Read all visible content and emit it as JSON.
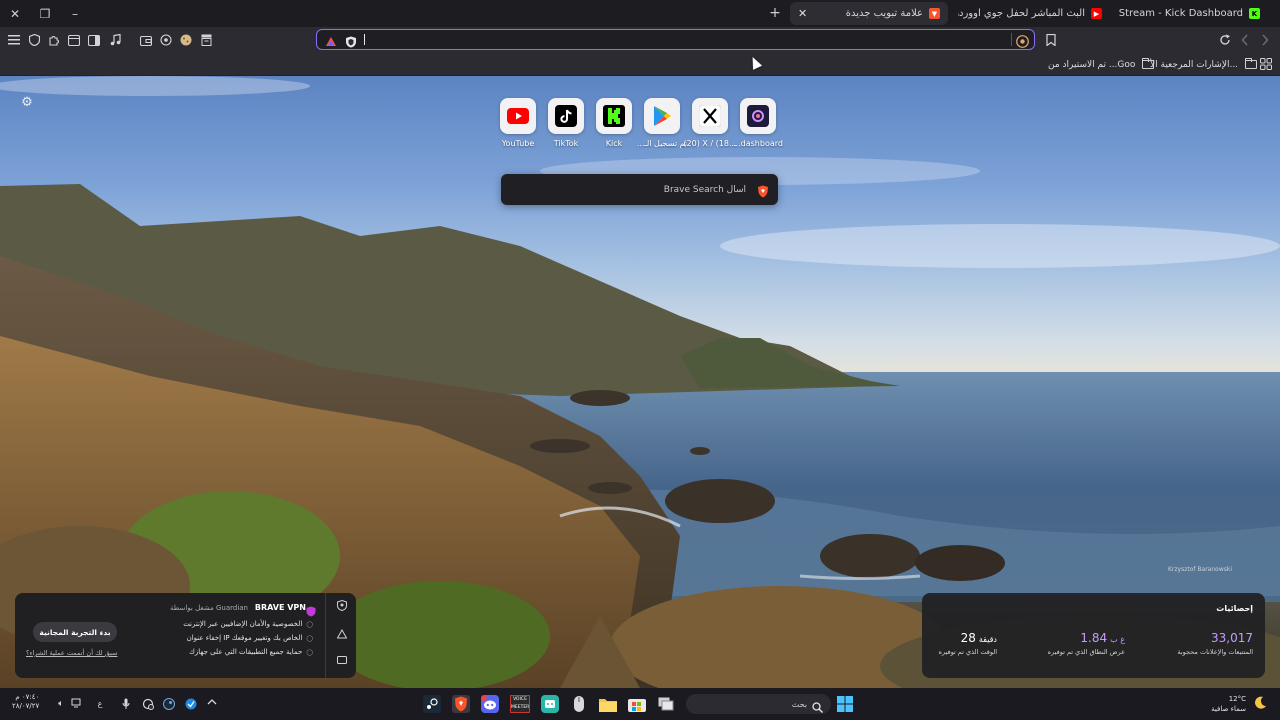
{
  "tabs": [
    {
      "title": "Stream - Kick Dashboard",
      "favicon": "kick-icon"
    },
    {
      "title": "البث المباشر لحفل جوي اووردز ٢٠٢٦",
      "favicon": "youtube-icon"
    },
    {
      "title": "علامة تبويب جديدة",
      "favicon": "brave-icon",
      "active": true
    }
  ],
  "window": {
    "close": "✕",
    "restore": "❐",
    "minimize": "–",
    "new_tab": "+"
  },
  "address_bar": {
    "value": "",
    "placeholder": ""
  },
  "bookmarks": [
    {
      "label": "الإشارات المرجعية الأ...",
      "icon": "folder-icon"
    },
    {
      "label": "تم الاستيراد من ...Goo",
      "icon": "folder-icon"
    }
  ],
  "top_sites": [
    {
      "label": "YouTube",
      "icon": "youtube-icon"
    },
    {
      "label": "TikTok",
      "icon": "tiktok-icon"
    },
    {
      "label": "Kick",
      "icon": "kick-icon"
    },
    {
      "label": "...تم تسجيل الـ",
      "icon": "google-play-icon"
    },
    {
      "label": "(20) X / (18...",
      "icon": "x-icon"
    },
    {
      "label": "...dashboard",
      "icon": "dashboard-icon"
    }
  ],
  "search": {
    "placeholder": "Brave Search اسأل"
  },
  "photo_credit": "Krzysztof Baranowski",
  "vpn": {
    "title": "BRAVE VPN",
    "powered_by": "مشغل بواسطة Guardian",
    "features": [
      "الخصوصية والأمان الإضافيين عبر الإنترنت",
      "إخفاء عنوان IP الخاص بك وتغيير موقعك",
      "حماية جميع التطبيقات التي على جهازك"
    ],
    "cta": "بدء التجربة المجانية",
    "restore_link": "سبق لك أن أتممت عملية الشراء؟"
  },
  "stats": {
    "title": "إحصائيات",
    "items": [
      {
        "value": "33,017",
        "unit": "",
        "label": "المتتبعات والإعلانات محجوبة",
        "color": "#c59bff"
      },
      {
        "value": "1.84",
        "unit": "غ ب",
        "label": "عرض النطاق الذي تم توفيره",
        "color": "#c59bff"
      },
      {
        "value": "28",
        "unit": "دقيقة",
        "label": "الوقت الذي تم توفيره",
        "color": "#ffffff"
      }
    ]
  },
  "taskbar": {
    "search_placeholder": "بحث",
    "weather_temp": "12°C",
    "weather_desc": "سماء صافية",
    "clock_time": "٠٧:٤٠ م",
    "clock_date": "٢٨/٠٧/٢٧",
    "language": "ع",
    "voice_badge": "VOICE MEETER"
  },
  "colors": {
    "accent": "#8a6cff",
    "brave_orange": "#fb542b",
    "kick_green": "#53fc18",
    "youtube_red": "#ff0000"
  }
}
